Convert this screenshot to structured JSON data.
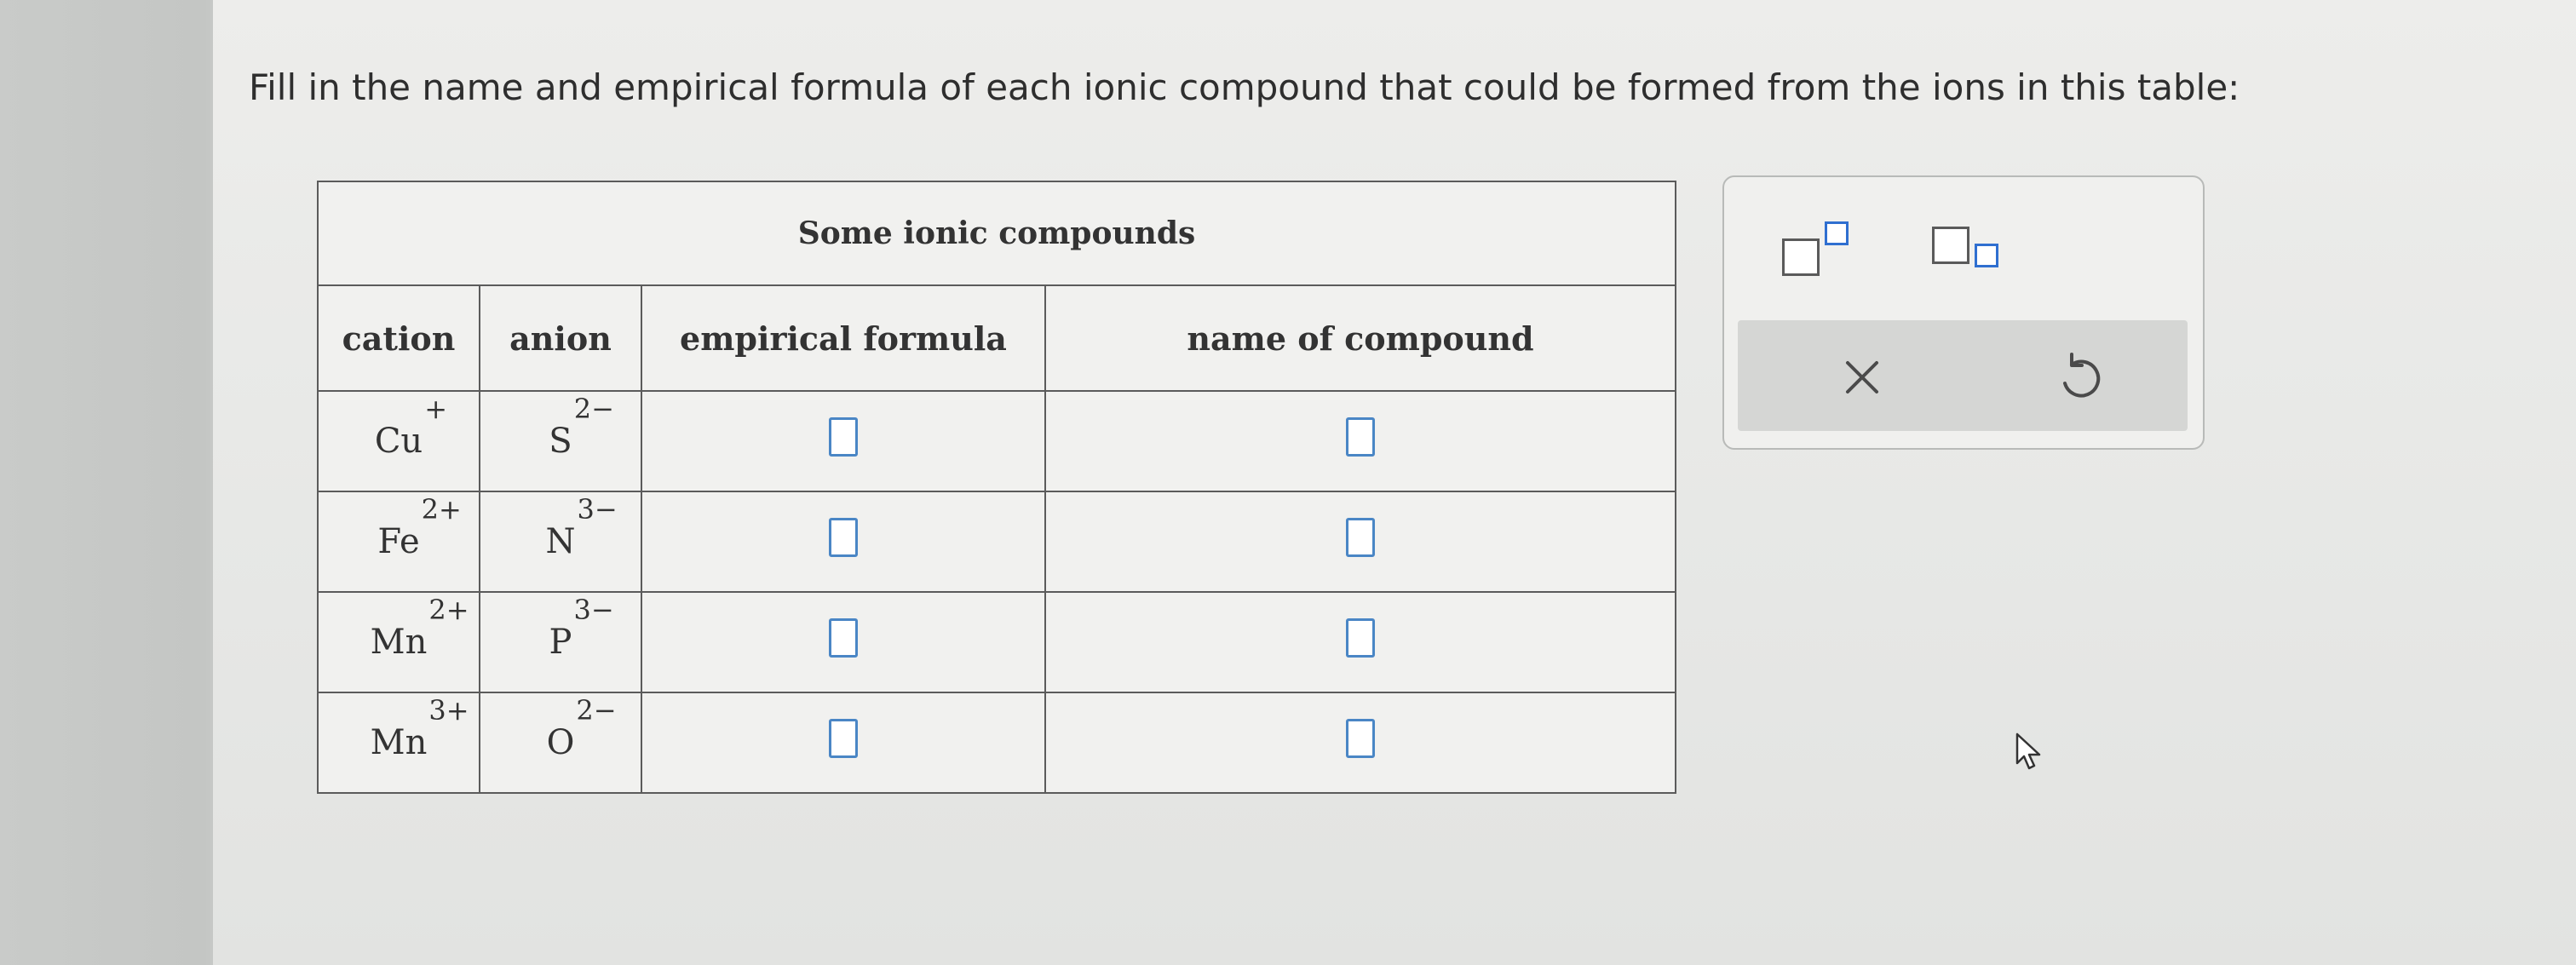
{
  "question": {
    "text": "Fill in the name and empirical formula of each ionic compound that could be formed from the ions in this table:"
  },
  "table": {
    "title": "Some ionic compounds",
    "headers": [
      "cation",
      "anion",
      "empirical formula",
      "name of compound"
    ],
    "rows": [
      {
        "cation": {
          "symbol": "Cu",
          "charge": "+"
        },
        "anion": {
          "symbol": "S",
          "charge": "2−"
        },
        "formula": "",
        "name": ""
      },
      {
        "cation": {
          "symbol": "Fe",
          "charge": "2+"
        },
        "anion": {
          "symbol": "N",
          "charge": "3−"
        },
        "formula": "",
        "name": ""
      },
      {
        "cation": {
          "symbol": "Mn",
          "charge": "2+"
        },
        "anion": {
          "symbol": "P",
          "charge": "3−"
        },
        "formula": "",
        "name": ""
      },
      {
        "cation": {
          "symbol": "Mn",
          "charge": "3+"
        },
        "anion": {
          "symbol": "O",
          "charge": "2−"
        },
        "formula": "",
        "name": ""
      }
    ]
  },
  "toolbar": {
    "superscript_icon": "superscript-icon",
    "subscript_icon": "subscript-icon",
    "clear_icon": "close-icon",
    "undo_icon": "undo-icon"
  },
  "colors": {
    "accent": "#2f6fd0",
    "input_border": "#4a86c5"
  }
}
